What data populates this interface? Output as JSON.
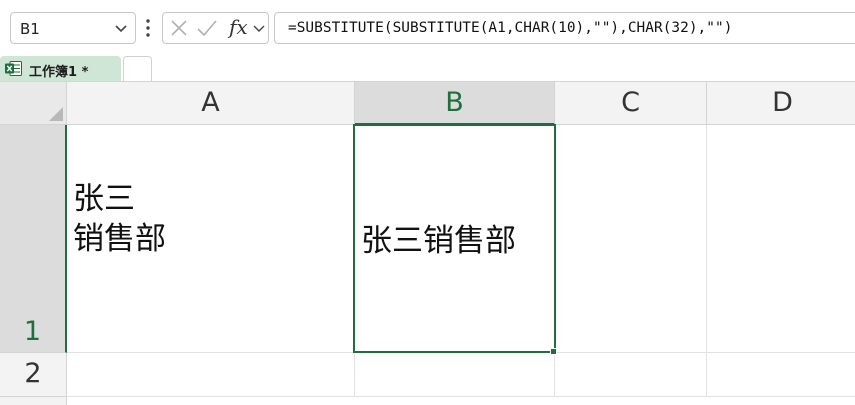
{
  "formula_bar": {
    "name_box": "B1",
    "formula": "=SUBSTITUTE(SUBSTITUTE(A1,CHAR(10),\"\"),CHAR(32),\"\")",
    "fx_label": "fx"
  },
  "tabs": {
    "workbook_label": "工作簿1 *"
  },
  "sheet": {
    "columns": [
      "A",
      "B",
      "C",
      "D"
    ],
    "rows": [
      "1",
      "2"
    ],
    "selected_cell": "B1",
    "cells": {
      "A1": "张三\n销售部",
      "B1": "张三销售部"
    }
  },
  "colors": {
    "accent_green": "#1e6f3e",
    "tab_green": "#cfe5d6",
    "header_gray": "#f3f3f3"
  }
}
